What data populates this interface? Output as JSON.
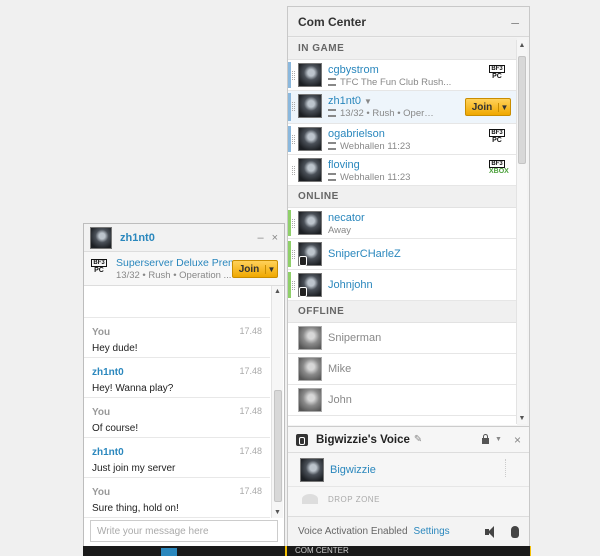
{
  "com_center": {
    "title": "Com Center",
    "minimize": "–",
    "sections": {
      "in_game": "IN GAME",
      "online": "ONLINE",
      "offline": "OFFLINE"
    },
    "in_game": [
      {
        "name": "cgbystrom",
        "status": "TFC The Fun Club Rush...",
        "platform_badge": "BF3",
        "platform": "PC"
      },
      {
        "name": "zh1nt0",
        "status": "13/32 • Rush • Operation...",
        "join_label": "Join"
      },
      {
        "name": "ogabrielson",
        "status": "Webhallen 11:23",
        "platform_badge": "BF3",
        "platform": "PC"
      },
      {
        "name": "floving",
        "status": "Webhallen 11:23",
        "platform_badge": "BF3",
        "platform": "XBOX"
      }
    ],
    "online": [
      {
        "name": "necator",
        "status": "Away"
      },
      {
        "name": "SniperCHarleZ"
      },
      {
        "name": "Johnjohn"
      }
    ],
    "offline": [
      {
        "name": "Sniperman"
      },
      {
        "name": "Mike"
      },
      {
        "name": "John"
      }
    ]
  },
  "voice": {
    "title": "Bigwizzie's Voice",
    "user": "Bigwizzie",
    "drop_zone": "DROP ZONE",
    "activation": "Voice Activation Enabled",
    "settings": "Settings",
    "close": "×"
  },
  "chat": {
    "title": "zh1nt0",
    "minimize": "–",
    "close": "×",
    "server_badge": "BF3",
    "server_platform": "PC",
    "server_name": "Superserver Deluxe Prem...",
    "server_info": "13/32 • Rush • Operation ...",
    "join_label": "Join",
    "messages": [
      {
        "who": "You",
        "time": "17.48",
        "text": "Hey dude!"
      },
      {
        "who": "zh1nt0",
        "time": "17.48",
        "text": "Hey! Wanna play?"
      },
      {
        "who": "You",
        "time": "17.48",
        "text": "Of course!"
      },
      {
        "who": "zh1nt0",
        "time": "17.48",
        "text": "Just join my server"
      },
      {
        "who": "You",
        "time": "17.48",
        "text": "Sure thing, hold on!"
      }
    ],
    "input_placeholder": "Write your message here"
  },
  "taskbar": {
    "com_label": "COM CENTER"
  },
  "colors": {
    "accent_link": "#2a87bd",
    "join_yellow": "#f0a800",
    "in_game_bar": "#8bb8dd",
    "online_bar": "#8fcf6a"
  }
}
